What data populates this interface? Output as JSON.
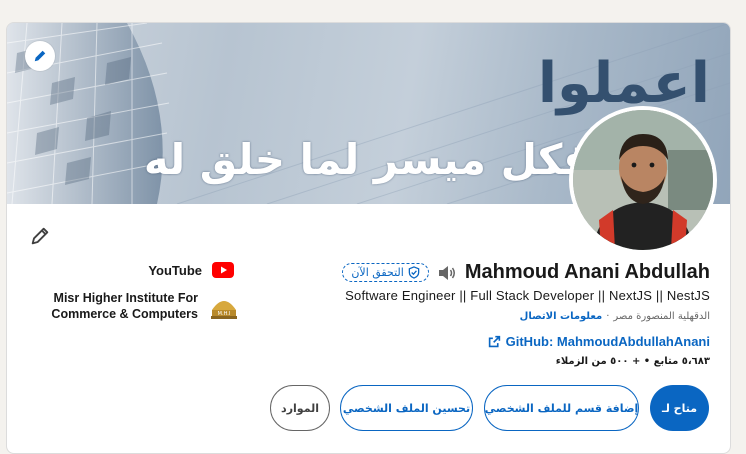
{
  "banner": {
    "line1": "اعملوا",
    "line2": "فكل ميسر لما خلق له"
  },
  "profile": {
    "name": "Mahmoud Anani Abdullah",
    "verify_label": "التحقق الآن",
    "headline": "Software Engineer || Full Stack Developer || NextJS || NestJS",
    "location": "الدقهلية المنصورة مصر",
    "separator": "·",
    "contact_info": "معلومات الاتصال",
    "github": "GitHub: MahmoudAbdullahAnani",
    "stats": "٥،٦٨٣ متابع • + ٥٠٠ من الزملاء"
  },
  "side": {
    "youtube_label": "YouTube",
    "institute_label": "Misr Higher Institute For Commerce & Computers",
    "institute_logo_text": "M.H.I"
  },
  "actions": {
    "open_to": "متاح لـ",
    "add_section": "إضافة قسم للملف الشخصي",
    "improve_profile": "تحسين الملف الشخصي",
    "resources": "الموارد"
  },
  "colors": {
    "brand_blue": "#0a66c2",
    "youtube_red": "#ff0000"
  },
  "icons": [
    "pencil-icon",
    "edit-icon",
    "speaker-icon",
    "verified-shield-icon",
    "external-link-icon",
    "youtube-icon",
    "institute-logo-icon"
  ]
}
